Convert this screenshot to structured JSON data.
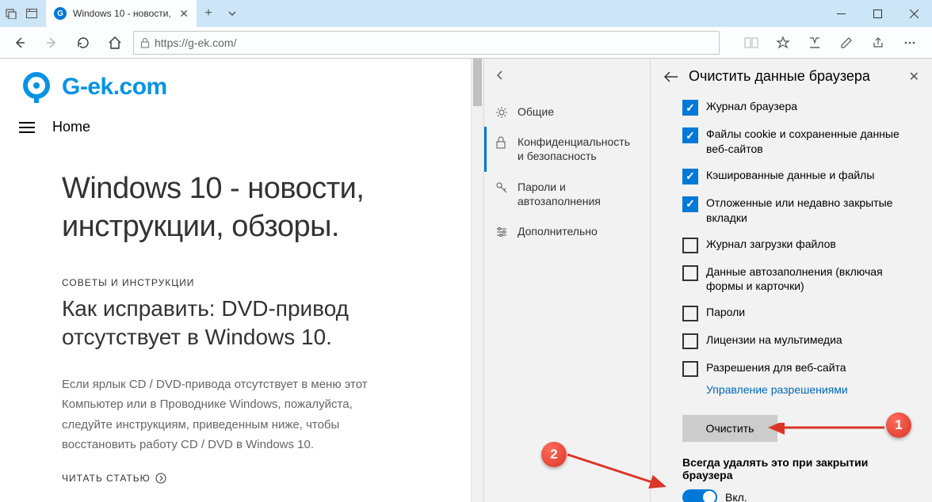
{
  "titlebar": {
    "tab_title": "Windows 10 - новости,"
  },
  "addressbar": {
    "url": "https://g-ek.com/"
  },
  "page": {
    "logo_text": "G-ek.com",
    "nav_home": "Home",
    "hero_title": "Windows 10 - новости, инструкции, обзоры.",
    "meta": "СОВЕТЫ И ИНСТРУКЦИИ",
    "article_title": "Как исправить: DVD-привод отсутствует в Windows 10.",
    "excerpt": "Если ярлык CD / DVD-привода отсутствует в меню этот Компьютер или в Проводнике Windows, пожалуйста, следуйте инструкциям, приведенным ниже, чтобы восстановить работу CD / DVD в Windows 10.",
    "readmore": "ЧИТАТЬ СТАТЬЮ"
  },
  "settings_mid": {
    "items": [
      {
        "label": "Общие"
      },
      {
        "label": "Конфиденциальность и безопасность"
      },
      {
        "label": "Пароли и автозаполнения"
      },
      {
        "label": "Дополнительно"
      }
    ]
  },
  "settings_right": {
    "title": "Очистить данные браузера",
    "checks": [
      {
        "label": "Журнал браузера",
        "checked": true
      },
      {
        "label": "Файлы cookie и сохраненные данные веб-сайтов",
        "checked": true
      },
      {
        "label": "Кэшированные данные и файлы",
        "checked": true
      },
      {
        "label": "Отложенные или недавно закрытые вкладки",
        "checked": true
      },
      {
        "label": "Журнал загрузки файлов",
        "checked": false
      },
      {
        "label": "Данные автозаполнения (включая формы и карточки)",
        "checked": false
      },
      {
        "label": "Пароли",
        "checked": false
      },
      {
        "label": "Лицензии на мультимедиа",
        "checked": false
      },
      {
        "label": "Разрешения для веб-сайта",
        "checked": false
      }
    ],
    "permissions_link": "Управление разрешениями",
    "clear_btn": "Очистить",
    "always_label": "Всегда удалять это при закрытии браузера",
    "toggle_label": "Вкл."
  },
  "callouts": {
    "c1": "1",
    "c2": "2"
  }
}
